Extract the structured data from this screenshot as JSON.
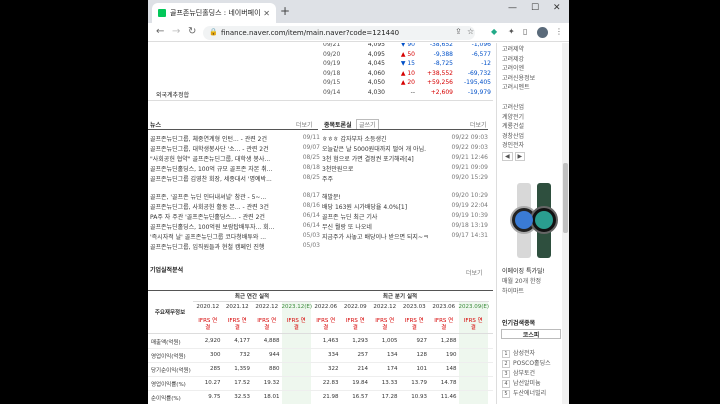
{
  "browser": {
    "tab_title": "골프존뉴딘홀딩스 : 네이버페이",
    "url": "finance.naver.com/item/main.naver?code=121440"
  },
  "daily_rows": [
    {
      "date": "09/21",
      "price": "4,095",
      "arrow": "▼",
      "change": "90",
      "volume": "-38,652",
      "inst": "-1,096"
    },
    {
      "date": "09/20",
      "price": "4,095",
      "arrow": "▲",
      "change": "50",
      "volume": "-9,388",
      "inst": "-6,577"
    },
    {
      "date": "09/19",
      "price": "4,045",
      "arrow": "▼",
      "change": "15",
      "volume": "-8,725",
      "inst": "-12"
    },
    {
      "date": "09/18",
      "price": "4,060",
      "arrow": "▲",
      "change": "10",
      "volume": "+38,552",
      "inst": "-69,732"
    },
    {
      "date": "09/15",
      "price": "4,050",
      "arrow": "▲",
      "change": "20",
      "volume": "+59,256",
      "inst": "-195,405"
    },
    {
      "date": "09/14",
      "price": "4,030",
      "arrow": "",
      "change": "--",
      "volume": "+2,609",
      "inst": "-19,979"
    }
  ],
  "foreign_label": "외국계추정합",
  "news": {
    "title": "뉴스",
    "more": "더보기",
    "items": [
      {
        "text": "골프존뉴딘그룹, 체중연계형 인턴... - 관련 2건",
        "date": "09/11"
      },
      {
        "text": "골프존뉴딘그룹, 대학생봉사단 '소... - 관련 2건",
        "date": "09/07"
      },
      {
        "text": "\"사회공헌 협약\" 골프존뉴딘그룹, 대학생 봉사...",
        "date": "08/25"
      },
      {
        "text": "골프존뉴딘홀딩스, 100억 규모 골프존 자본 취...",
        "date": "08/18"
      },
      {
        "text": "골프존뉴딘그룹 김영찬 회장, 세종대서 '명예박...",
        "date": "08/25"
      },
      {
        "text": "골프존, '골프존 뉴딘 인터내셔널' 참관 - 5~...",
        "date": "08/17"
      },
      {
        "text": "골프존뉴딘그룹, 사회공헌 활동 본... - 관련 3건",
        "date": "08/16"
      },
      {
        "text": "PA주 자 주관 '골프존뉴딘홀딩스... - 관련 2건",
        "date": "06/14"
      },
      {
        "text": "골프존뉴딘홀딩스, 100억원 보람탑배투자... 회...",
        "date": "06/14"
      },
      {
        "text": "'즉시자적 날' 골프존뉴딘그룹 코다청배투와 ...",
        "date": "05/03"
      },
      {
        "text": "골프존뉴딘그룹, 임직원들과 현철 캠페인 진행",
        "date": "05/03"
      }
    ]
  },
  "board": {
    "title": "종목토론실",
    "tag": "글쓰기",
    "more": "더보기",
    "items": [
      {
        "text": "ㅎㅎㅎ 갑자부자 소등생긴",
        "date": "09/22 09:03"
      },
      {
        "text": "오늘같은 날 5000원대까지 떨어 개 아님.",
        "date": "09/22 09:03"
      },
      {
        "text": "3천 험으로 가면 결정권 포기해라[4]",
        "date": "09/21 12:46"
      },
      {
        "text": "3천만원으로",
        "date": "09/21 09:09"
      },
      {
        "text": "주주",
        "date": "09/20 15:29"
      },
      {
        "text": "해발문!",
        "date": "09/20 10:29"
      },
      {
        "text": "배당 163원 시가배당율 4.0%[1]",
        "date": "09/19 22:04"
      },
      {
        "text": "골프존 뉴딘 최근 기사",
        "date": "09/19 10:39"
      },
      {
        "text": "무신 뭘랑 또 나오네",
        "date": "09/18 13:19"
      },
      {
        "text": "지금주가 사놓고 배당이나 받으면 되지~ㅋ",
        "date": "09/17 14:31"
      }
    ]
  },
  "financial": {
    "title": "기업실적분석",
    "more": "더보기",
    "annual_header": "최근 연간 실적",
    "quarter_header": "최근 분기 실적",
    "row_header": "주요재무정보",
    "annual_years": [
      "2020.12",
      "2021.12",
      "2022.12",
      "2023.12(E)"
    ],
    "quarter_years": [
      "2022.06",
      "2022.09",
      "2022.12",
      "2023.03",
      "2023.06",
      "2023.09(E)"
    ],
    "ifrs_label": "IFRS 연결",
    "rows": [
      {
        "label": "매출액(억원)",
        "annual": [
          "2,920",
          "4,177",
          "4,888",
          ""
        ],
        "quarter": [
          "1,463",
          "1,293",
          "1,005",
          "927",
          "1,288",
          ""
        ]
      },
      {
        "label": "영업이익(억원)",
        "annual": [
          "300",
          "732",
          "944",
          ""
        ],
        "quarter": [
          "334",
          "257",
          "134",
          "128",
          "190",
          ""
        ]
      },
      {
        "label": "당기순이익(억원)",
        "annual": [
          "285",
          "1,359",
          "880",
          ""
        ],
        "quarter": [
          "322",
          "214",
          "174",
          "101",
          "148",
          ""
        ]
      },
      {
        "label": "영업이익률(%)",
        "annual": [
          "10.27",
          "17.52",
          "19.32",
          ""
        ],
        "quarter": [
          "22.83",
          "19.84",
          "13.33",
          "13.79",
          "14.78",
          ""
        ]
      },
      {
        "label": "순이익률(%)",
        "annual": [
          "9.75",
          "32.53",
          "18.01",
          ""
        ],
        "quarter": [
          "21.98",
          "16.57",
          "17.28",
          "10.93",
          "11.46",
          ""
        ]
      }
    ]
  },
  "sidebar": {
    "items_top": [
      "고려제약",
      "고려제강",
      "고려이엔",
      "고려신용정보",
      "고려시멘트"
    ],
    "items_mid": [
      "고려산업",
      "계양전기",
      "계룡건설",
      "경창산업",
      "경인전자"
    ],
    "ad_title": "이메이징 특가딜!",
    "ad_line2": "매월 20개 한정",
    "ad_line3": "하이마트",
    "popular_title": "인기검색종목",
    "popular_tab": "코스피",
    "popular_items": [
      "삼성전자",
      "POSCO홀딩스",
      "삼부토건",
      "남선알미늄",
      "두산에너빌리"
    ]
  }
}
